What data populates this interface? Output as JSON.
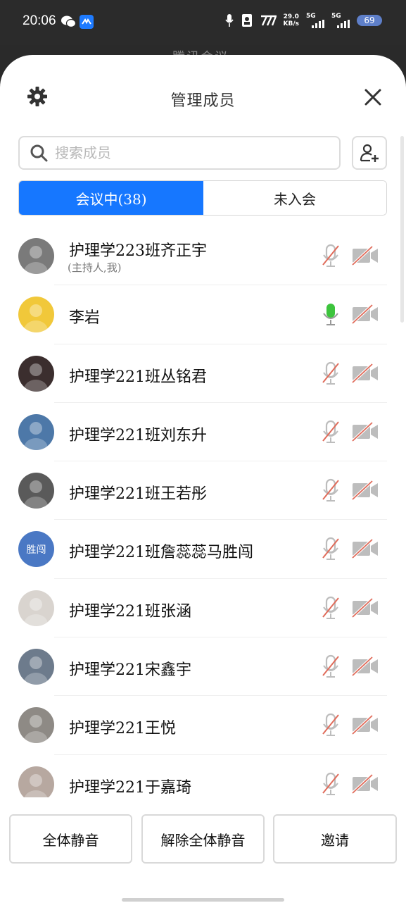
{
  "status_bar": {
    "time": "20:06",
    "speed_value": "29.0",
    "speed_unit": "KB/s",
    "net1": "5G",
    "net2": "5G",
    "battery": "69"
  },
  "background_title": "腾讯会议",
  "sheet": {
    "title": "管理成员",
    "search_placeholder": "搜索成员",
    "tabs": [
      {
        "label": "会议中(38)",
        "active": true
      },
      {
        "label": "未入会",
        "active": false
      }
    ]
  },
  "members": [
    {
      "name": "护理学223班齐正宇",
      "sub": "(主持人,我)",
      "mic": "muted",
      "avatar_kind": "photo",
      "avatar_color": "#7a7a7a"
    },
    {
      "name": "李岩",
      "sub": "",
      "mic": "on",
      "avatar_kind": "photo",
      "avatar_color": "#f1c83a"
    },
    {
      "name": "护理学221班丛铭君",
      "sub": "",
      "mic": "muted",
      "avatar_kind": "photo",
      "avatar_color": "#3b2e2e"
    },
    {
      "name": "护理学221班刘东升",
      "sub": "",
      "mic": "muted",
      "avatar_kind": "photo",
      "avatar_color": "#4d78a8"
    },
    {
      "name": "护理学221班王若彤",
      "sub": "",
      "mic": "muted",
      "avatar_kind": "photo",
      "avatar_color": "#5a5a5a"
    },
    {
      "name": "护理学221班詹蕊蕊马胜闯",
      "sub": "",
      "mic": "muted",
      "avatar_kind": "text",
      "avatar_text": "胜闯",
      "avatar_color": "#4a78c4"
    },
    {
      "name": "护理学221班张涵",
      "sub": "",
      "mic": "muted",
      "avatar_kind": "photo",
      "avatar_color": "#d9d4cf"
    },
    {
      "name": "护理学221宋鑫宇",
      "sub": "",
      "mic": "muted",
      "avatar_kind": "photo",
      "avatar_color": "#6d7b8c"
    },
    {
      "name": "护理学221王悦",
      "sub": "",
      "mic": "muted",
      "avatar_kind": "photo",
      "avatar_color": "#8e8a85"
    },
    {
      "name": "护理学221于嘉琦",
      "sub": "",
      "mic": "muted",
      "avatar_kind": "photo",
      "avatar_color": "#b7a8a0"
    }
  ],
  "footer": {
    "mute_all": "全体静音",
    "unmute_all": "解除全体静音",
    "invite": "邀请"
  },
  "colors": {
    "accent": "#1677ff",
    "mic_on": "#3dc43d",
    "muted_slash": "#e06b5a",
    "icon_gray": "#bdbdbd"
  }
}
